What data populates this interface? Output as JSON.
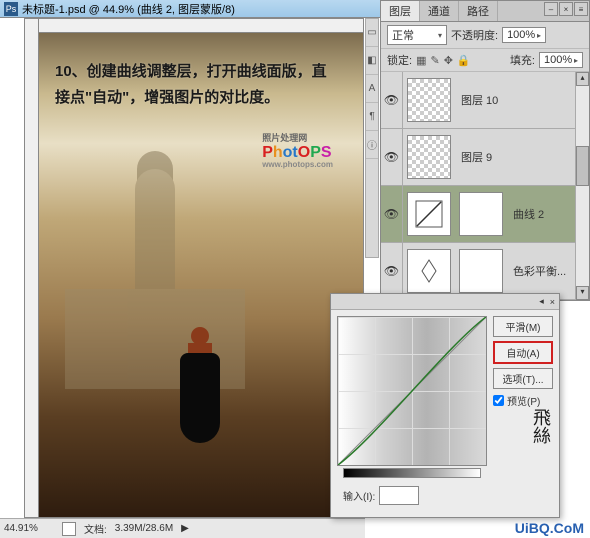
{
  "window": {
    "title": "未标题-1.psd @ 44.9% (曲线 2, 图层蒙版/8)"
  },
  "canvas": {
    "instruction": "10、创建曲线调整层，打开曲线面版，直接点\"自动\"，增强图片的对比度。",
    "logo_sub1": "照片处理网",
    "logo_text": "PhotOPS",
    "logo_sub2": "www.photops.com"
  },
  "status": {
    "zoom": "44.91%",
    "doc_label": "文档:",
    "doc_size": "3.39M/28.6M"
  },
  "layers_panel": {
    "tabs": [
      "图层",
      "通道",
      "路径"
    ],
    "blend_mode": "正常",
    "opacity_label": "不透明度:",
    "opacity_value": "100%",
    "lock_label": "锁定:",
    "fill_label": "填充:",
    "fill_value": "100%",
    "layers": [
      {
        "name": "图层 10",
        "type": "trans"
      },
      {
        "name": "图层 9",
        "type": "trans"
      },
      {
        "name": "曲线 2",
        "type": "curves",
        "selected": true
      },
      {
        "name": "色彩平衡...",
        "type": "adj"
      }
    ]
  },
  "curves": {
    "smooth_btn": "平滑(M)",
    "auto_btn": "自动(A)",
    "options_btn": "选项(T)...",
    "preview_label": "预览(P)",
    "input_label": "输入(I):",
    "input_value": ""
  },
  "watermark": "UiBQ.CoM",
  "calligraphy": "飛絲"
}
